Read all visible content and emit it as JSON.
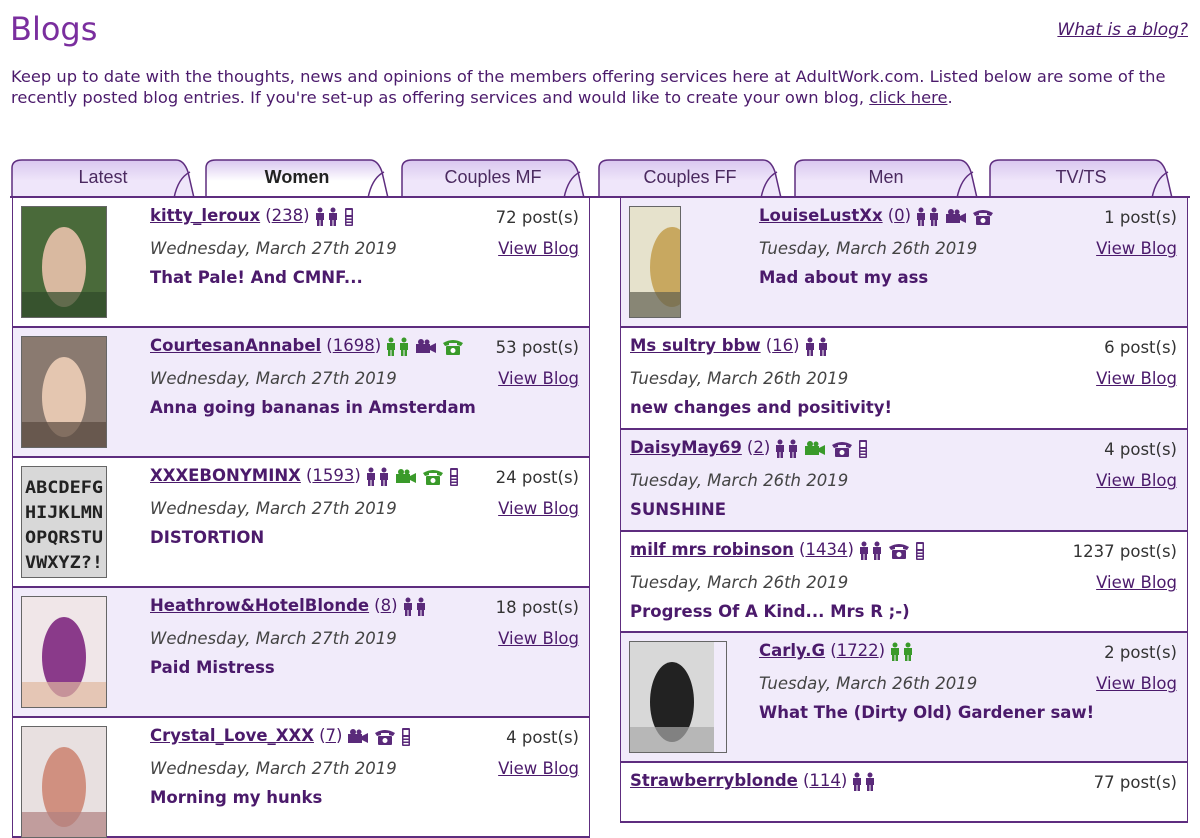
{
  "header": {
    "title": "Blogs",
    "what_is_link": "What is a blog?",
    "intro_text": "Keep up to date with the thoughts, news and opinions of the members offering services here at AdultWork.com.  Listed below are some of the recently posted blog entries.  If you're set-up as offering services and would like to create your own blog,",
    "intro_link": "click here",
    "intro_end": "."
  },
  "tabs": [
    {
      "label": "Latest",
      "active": false
    },
    {
      "label": "Women",
      "active": true
    },
    {
      "label": "Couples MF",
      "active": false
    },
    {
      "label": "Couples FF",
      "active": false
    },
    {
      "label": "Men",
      "active": false
    },
    {
      "label": "TV/TS",
      "active": false
    }
  ],
  "view_blog_label": "View Blog",
  "colors": {
    "accent": "#7a2e9e",
    "link": "#4b1a6b",
    "border": "#5e2d7f",
    "alt_row": "#f1ebfa",
    "icon_purple": "#5a2a7a",
    "icon_green": "#3a9a2a"
  },
  "left_entries": [
    {
      "name": "kitty_leroux",
      "count": "238",
      "posts": "72 post(s)",
      "date": "Wednesday, March 27th 2019",
      "title": "That Pale! And CMNF...",
      "icons": [
        "people-purple",
        "mobile-purple"
      ]
    },
    {
      "name": "CourtesanAnnabel",
      "count": "1698",
      "posts": "53 post(s)",
      "date": "Wednesday, March 27th 2019",
      "title": "Anna going bananas in Amsterdam",
      "icons": [
        "people-green",
        "camera-purple",
        "phone-green"
      ]
    },
    {
      "name": "XXXEBONYMINX",
      "count": "1593",
      "posts": "24 post(s)",
      "date": "Wednesday, March 27th 2019",
      "title": "DISTORTION",
      "icons": [
        "people-purple",
        "camera-green",
        "phone-green",
        "mobile-purple"
      ]
    },
    {
      "name": "Heathrow&HotelBlonde",
      "count": "8",
      "posts": "18 post(s)",
      "date": "Wednesday, March 27th 2019",
      "title": "Paid Mistress",
      "icons": [
        "people-purple"
      ]
    },
    {
      "name": "Crystal_Love_XXX",
      "count": "7",
      "posts": "4 post(s)",
      "date": "Wednesday, March 27th 2019",
      "title": "Morning my hunks",
      "icons": [
        "camera-purple",
        "phone-purple",
        "mobile-purple"
      ]
    }
  ],
  "right_entries": [
    {
      "name": "LouiseLustXx",
      "count": "0",
      "posts": "1 post(s)",
      "date": "Tuesday, March 26th 2019",
      "title": "Mad about my ass",
      "icons": [
        "people-purple",
        "camera-purple",
        "phone-purple"
      ]
    },
    {
      "name": "Ms sultry bbw",
      "count": "16",
      "posts": "6 post(s)",
      "date": "Tuesday, March 26th 2019",
      "title": "new changes and positivity!",
      "icons": [
        "people-purple"
      ]
    },
    {
      "name": "DaisyMay69",
      "count": "2",
      "posts": "4 post(s)",
      "date": "Tuesday, March 26th 2019",
      "title": "SUNSHINE",
      "icons": [
        "people-purple",
        "camera-green",
        "phone-purple",
        "mobile-purple"
      ]
    },
    {
      "name": "milf mrs robinson",
      "count": "1434",
      "posts": "1237 post(s)",
      "date": "Tuesday, March 26th 2019",
      "title": "Progress Of A Kind... Mrs R ;-)",
      "icons": [
        "people-purple",
        "phone-purple",
        "mobile-purple"
      ]
    },
    {
      "name": "Carly.G",
      "count": "1722",
      "posts": "2 post(s)",
      "date": "Tuesday, March 26th 2019",
      "title": "What The (Dirty Old) Gardener saw!",
      "icons": [
        "people-green"
      ]
    },
    {
      "name": "Strawberryblonde",
      "count": "114",
      "posts": "77 post(s)",
      "date": "",
      "title": "",
      "icons": [
        "people-purple"
      ]
    }
  ],
  "thumb3_text": [
    "ABCDEFG",
    "HIJKLMN",
    "OPQRSTU",
    "VWXYZ?!"
  ]
}
